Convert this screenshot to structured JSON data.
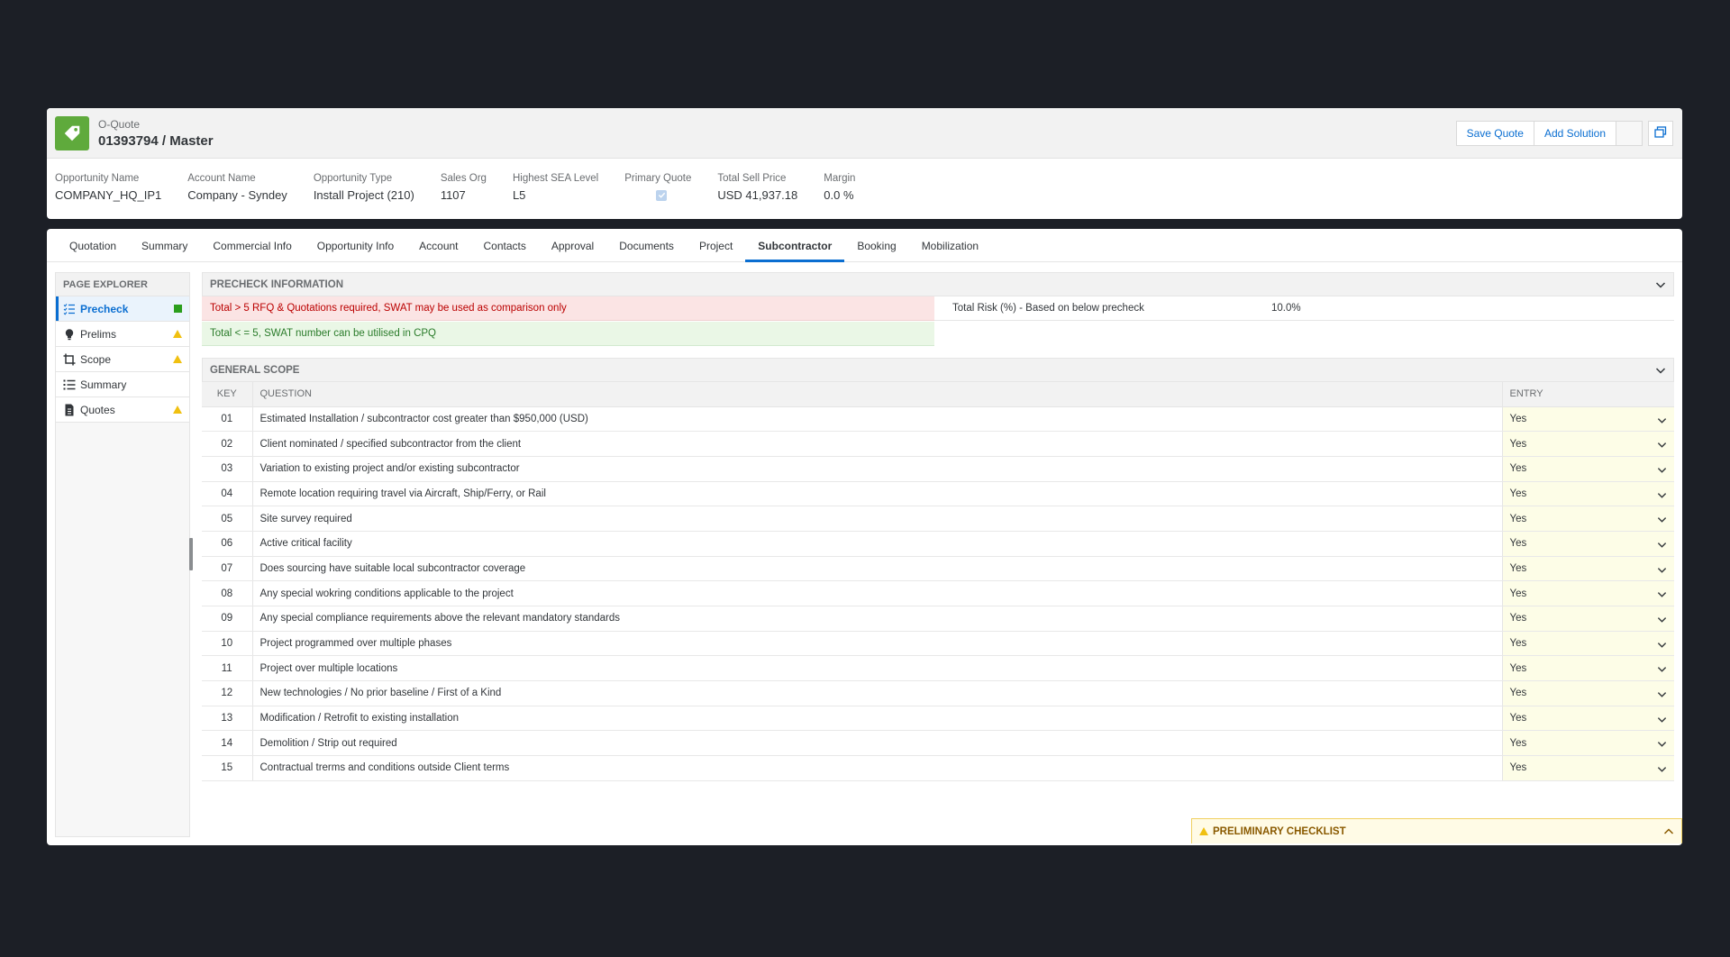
{
  "header": {
    "object_type": "O-Quote",
    "title": "01393794 / Master",
    "actions": {
      "save_quote": "Save Quote",
      "add_solution": "Add Solution"
    },
    "fields": [
      {
        "label": "Opportunity Name",
        "value": "COMPANY_HQ_IP1"
      },
      {
        "label": "Account Name",
        "value": "Company - Syndey"
      },
      {
        "label": "Opportunity Type",
        "value": "Install Project (210)"
      },
      {
        "label": "Sales Org",
        "value": "1107"
      },
      {
        "label": "Highest SEA Level",
        "value": "L5"
      },
      {
        "label": "Primary Quote",
        "value": ""
      },
      {
        "label": "Total Sell Price",
        "value": "USD 41,937.18"
      },
      {
        "label": "Margin",
        "value": "0.0 %"
      }
    ]
  },
  "tabs": [
    "Quotation",
    "Summary",
    "Commercial Info",
    "Opportunity Info",
    "Account",
    "Contacts",
    "Approval",
    "Documents",
    "Project",
    "Subcontractor",
    "Booking",
    "Mobilization"
  ],
  "active_tab": "Subcontractor",
  "sidebar": {
    "title": "PAGE EXPLORER",
    "items": [
      {
        "label": "Precheck",
        "icon": "checklist-icon",
        "status": "complete"
      },
      {
        "label": "Prelims",
        "icon": "lightbulb-icon",
        "status": "warning"
      },
      {
        "label": "Scope",
        "icon": "crop-icon",
        "status": "warning"
      },
      {
        "label": "Summary",
        "icon": "list-icon",
        "status": ""
      },
      {
        "label": "Quotes",
        "icon": "document-icon",
        "status": "warning"
      }
    ]
  },
  "precheck": {
    "title": "PRECHECK INFORMATION",
    "msg_red": "Total > 5 RFQ & Quotations required, SWAT may be used as comparison only",
    "msg_green": "Total < = 5, SWAT number can be utilised in CPQ",
    "risk_label": "Total Risk (%) - Based on below precheck",
    "risk_value": "10.0%"
  },
  "general_scope": {
    "title": "GENERAL SCOPE",
    "columns": {
      "key": "KEY",
      "question": "QUESTION",
      "entry": "ENTRY"
    },
    "rows": [
      {
        "key": "01",
        "question": "Estimated Installation / subcontractor cost greater than $950,000 (USD)",
        "entry": "Yes"
      },
      {
        "key": "02",
        "question": "Client nominated / specified subcontractor from the client",
        "entry": "Yes"
      },
      {
        "key": "03",
        "question": "Variation to existing project and/or existing subcontractor",
        "entry": "Yes"
      },
      {
        "key": "04",
        "question": "Remote location requiring travel via Aircraft, Ship/Ferry, or Rail",
        "entry": "Yes"
      },
      {
        "key": "05",
        "question": "Site survey required",
        "entry": "Yes"
      },
      {
        "key": "06",
        "question": "Active critical facility",
        "entry": "Yes"
      },
      {
        "key": "07",
        "question": "Does sourcing have suitable local subcontractor coverage",
        "entry": "Yes"
      },
      {
        "key": "08",
        "question": "Any special wokring conditions applicable to the project",
        "entry": "Yes"
      },
      {
        "key": "09",
        "question": "Any special compliance requirements above the relevant mandatory standards",
        "entry": "Yes"
      },
      {
        "key": "10",
        "question": "Project programmed over multiple phases",
        "entry": "Yes"
      },
      {
        "key": "11",
        "question": "Project over multiple locations",
        "entry": "Yes"
      },
      {
        "key": "12",
        "question": "New technologies / No prior baseline / First of a Kind",
        "entry": "Yes"
      },
      {
        "key": "13",
        "question": "Modification / Retrofit to existing installation",
        "entry": "Yes"
      },
      {
        "key": "14",
        "question": "Demolition / Strip out required",
        "entry": "Yes"
      },
      {
        "key": "15",
        "question": "Contractual trerms and conditions outside Client terms",
        "entry": "Yes"
      }
    ]
  },
  "preliminary_checklist": {
    "title": "PRELIMINARY CHECKLIST"
  },
  "colors": {
    "accent": "#0a6ed1",
    "logo": "#5faa3c",
    "error": "#bb0000",
    "success": "#2b9e1d",
    "warning": "#f0c010"
  }
}
